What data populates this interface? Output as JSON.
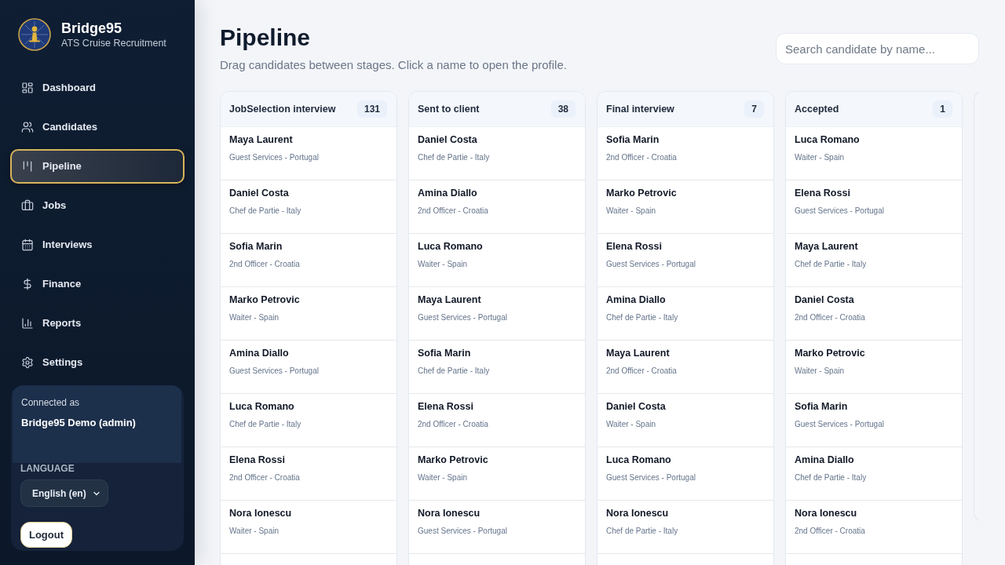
{
  "sidebar": {
    "brand": {
      "name": "Bridge95",
      "tagline": "ATS Cruise Recruitment"
    },
    "nav_items": [
      {
        "label": "Dashboard",
        "selected": false
      },
      {
        "label": "Candidates",
        "selected": false
      },
      {
        "label": "Pipeline",
        "selected": true
      },
      {
        "label": "Jobs",
        "selected": false
      },
      {
        "label": "Interviews",
        "selected": false
      },
      {
        "label": "Finance",
        "selected": false
      },
      {
        "label": "Reports",
        "selected": false
      },
      {
        "label": "Settings",
        "selected": false
      }
    ],
    "account": {
      "caption": "Connected as",
      "user": "Bridge95 Demo (admin)"
    },
    "language": {
      "label": "LANGUAGE",
      "value": "English (en)"
    },
    "logout_button": "Logout"
  },
  "header": {
    "title": "Pipeline",
    "subtitle": "Drag candidates between stages. Click a name to open the profile.",
    "search": {
      "placeholder": "Search candidate by name..."
    }
  },
  "board": {
    "columns": [
      {
        "title": "JobSelection interview",
        "count": "131",
        "cards": [
          {
            "name": "Maya Laurent",
            "detail": "Guest Services - Portugal"
          },
          {
            "name": "Daniel Costa",
            "detail": "Chef de Partie - Italy"
          },
          {
            "name": "Sofia Marin",
            "detail": "2nd Officer - Croatia"
          },
          {
            "name": "Marko Petrovic",
            "detail": "Waiter - Spain"
          },
          {
            "name": "Amina Diallo",
            "detail": "Guest Services - Portugal"
          },
          {
            "name": "Luca Romano",
            "detail": "Chef de Partie - Italy"
          },
          {
            "name": "Elena Rossi",
            "detail": "2nd Officer - Croatia"
          },
          {
            "name": "Nora Ionescu",
            "detail": "Waiter - Spain"
          }
        ]
      },
      {
        "title": "Sent to client",
        "count": "38",
        "cards": [
          {
            "name": "Daniel Costa",
            "detail": "Chef de Partie - Italy"
          },
          {
            "name": "Amina Diallo",
            "detail": "2nd Officer - Croatia"
          },
          {
            "name": "Luca Romano",
            "detail": "Waiter - Spain"
          },
          {
            "name": "Maya Laurent",
            "detail": "Guest Services - Portugal"
          },
          {
            "name": "Sofia Marin",
            "detail": "Chef de Partie - Italy"
          },
          {
            "name": "Elena Rossi",
            "detail": "2nd Officer - Croatia"
          },
          {
            "name": "Marko Petrovic",
            "detail": "Waiter - Spain"
          },
          {
            "name": "Nora Ionescu",
            "detail": "Guest Services - Portugal"
          }
        ]
      },
      {
        "title": "Final interview",
        "count": "7",
        "cards": [
          {
            "name": "Sofia Marin",
            "detail": "2nd Officer - Croatia"
          },
          {
            "name": "Marko Petrovic",
            "detail": "Waiter - Spain"
          },
          {
            "name": "Elena Rossi",
            "detail": "Guest Services - Portugal"
          },
          {
            "name": "Amina Diallo",
            "detail": "Chef de Partie - Italy"
          },
          {
            "name": "Maya Laurent",
            "detail": "2nd Officer - Croatia"
          },
          {
            "name": "Daniel Costa",
            "detail": "Waiter - Spain"
          },
          {
            "name": "Luca Romano",
            "detail": "Guest Services - Portugal"
          },
          {
            "name": "Nora Ionescu",
            "detail": "Chef de Partie - Italy"
          }
        ]
      },
      {
        "title": "Accepted",
        "count": "1",
        "cards": [
          {
            "name": "Luca Romano",
            "detail": "Waiter - Spain"
          },
          {
            "name": "Elena Rossi",
            "detail": "Guest Services - Portugal"
          },
          {
            "name": "Maya Laurent",
            "detail": "Chef de Partie - Italy"
          },
          {
            "name": "Daniel Costa",
            "detail": "2nd Officer - Croatia"
          },
          {
            "name": "Marko Petrovic",
            "detail": "Waiter - Spain"
          },
          {
            "name": "Sofia Marin",
            "detail": "Guest Services - Portugal"
          },
          {
            "name": "Amina Diallo",
            "detail": "Chef de Partie - Italy"
          },
          {
            "name": "Nora Ionescu",
            "detail": "2nd Officer - Croatia"
          }
        ]
      }
    ]
  }
}
